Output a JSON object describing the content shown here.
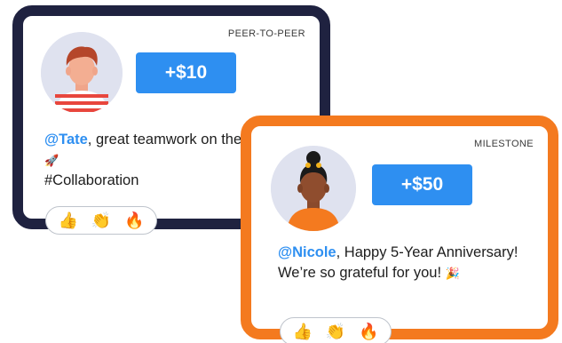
{
  "cards": [
    {
      "tag": "PEER-TO-PEER",
      "amount": "+$10",
      "mention": "@Tate",
      "message_text": ", great teamwork on the project! ",
      "message_emoji": "🚀",
      "message_tail": "#Collaboration",
      "reactions": [
        "👍",
        "👏",
        "🔥"
      ],
      "border_color": "#1f2240"
    },
    {
      "tag": "MILESTONE",
      "amount": "+$50",
      "mention": "@Nicole",
      "message_text": ", Happy 5-Year Anniversary! We’re so grateful for you! ",
      "message_emoji": "🎉",
      "message_tail": "",
      "reactions": [
        "👍",
        "👏",
        "🔥"
      ],
      "border_color": "#f47a1f"
    }
  ],
  "colors": {
    "accent_blue": "#2e8ff1",
    "navy": "#1f2240",
    "orange": "#f47a1f"
  }
}
